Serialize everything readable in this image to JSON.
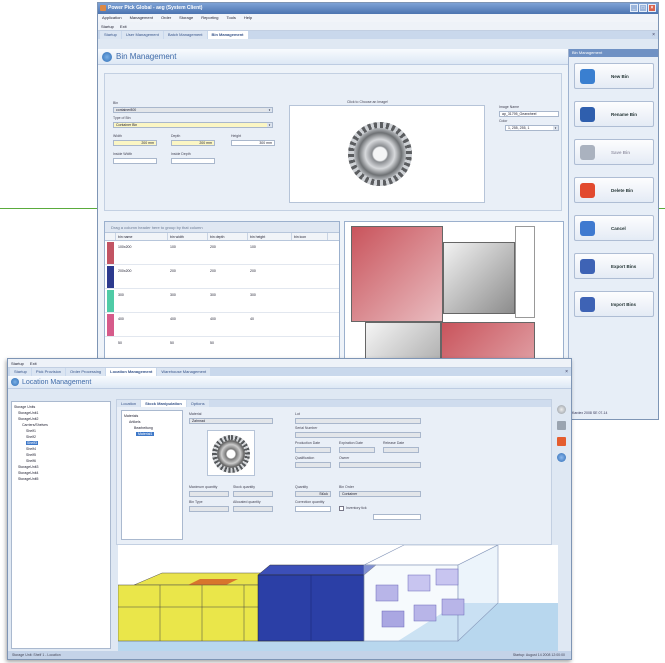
{
  "colors": {
    "accent": "#3e6aa8",
    "green_line": "#5aab3c",
    "red_block": "#c9545c",
    "yellow": "#f0ec4a",
    "blue": "#2a3fa8"
  },
  "window1": {
    "title": "Power Pick Global - aeg (System Client)",
    "menu": [
      "Application",
      "Management",
      "Order",
      "Storage",
      "Reporting",
      "Tools",
      "Help"
    ],
    "toolbar": [
      "Startup",
      "Exit"
    ],
    "tabs": [
      "Startup",
      "User Management",
      "Batch Management",
      "Bin Management"
    ],
    "header": "Bin Management",
    "form": {
      "bin_label": "Bin",
      "bin_value": "container800",
      "type_label": "Type of Bin",
      "type_value": "Container Bin",
      "width_label": "Width",
      "width_value": "200 mm",
      "depth_label": "Depth",
      "depth_value": "200 mm",
      "height_label": "Height",
      "height_value": "300 mm",
      "inside_width_label": "Inside Width",
      "inside_depth_label": "Inside Depth",
      "image_caption": "Click to Choose an Image!",
      "image_name_label": "Image Name",
      "image_name_value": "ap_31795_Gearwheel",
      "color_label": "Color",
      "color_value": "1, 255, 255, 1"
    },
    "grid": {
      "group_hint": "Drag a column header here to group by that column",
      "columns": [
        "bin name",
        "bin width",
        "bin depth",
        "bin height",
        "bin icon"
      ],
      "rows": [
        {
          "name": "100x200",
          "w": "100",
          "d": "200",
          "h": "100",
          "color": "#c25463"
        },
        {
          "name": "200x200",
          "w": "200",
          "d": "200",
          "h": "200",
          "color": "#2c3a8e"
        },
        {
          "name": "300",
          "w": "300",
          "d": "300",
          "h": "300",
          "color": "#4fcba6"
        },
        {
          "name": "400",
          "w": "400",
          "d": "400",
          "h": "40",
          "color": "#d65b8a"
        },
        {
          "name": "50",
          "w": "50",
          "d": "50",
          "h": "",
          "color": "#ffffff"
        }
      ]
    },
    "side_panel": {
      "title": "Bin Management",
      "buttons": [
        {
          "label": "New Bin",
          "icon": "new-bin-icon",
          "color": "#3a7fd0",
          "enabled": true
        },
        {
          "label": "Rename Bin",
          "icon": "save-icon",
          "color": "#2f5fae",
          "enabled": true
        },
        {
          "label": "Save Bin",
          "icon": "save-disabled-icon",
          "color": "#aab2bf",
          "enabled": false
        },
        {
          "label": "Delete Bin",
          "icon": "delete-icon",
          "color": "#e24a2f",
          "enabled": true
        },
        {
          "label": "Cancel",
          "icon": "undo-icon",
          "color": "#3f7ad0",
          "enabled": true
        },
        {
          "label": "Export Bins",
          "icon": "export-icon",
          "color": "#3e63b5",
          "enabled": true
        },
        {
          "label": "Import Bins",
          "icon": "import-icon",
          "color": "#3e63b5",
          "enabled": true
        }
      ],
      "footer": "Kardex 2008 SE 07-14"
    }
  },
  "window2": {
    "toolbar": [
      "Startup",
      "Exit"
    ],
    "tabs": [
      "Startup",
      "Pick Provision",
      "Order Processing",
      "Location Management",
      "Warehouse Management"
    ],
    "header": "Location Management",
    "tree": [
      "Storage Units",
      "StorageUnit1",
      "StorageUnit2",
      "Carriers/Shelves",
      "Shelf1",
      "Shelf2",
      "Shelf3",
      "Shelf4",
      "Shelf5",
      "Shelf6",
      "StorageUnit3",
      "StorageUnit4",
      "StorageUnit5"
    ],
    "subtabs": [
      "Location",
      "Stock Manipulation",
      "Options"
    ],
    "material_tree": [
      "Materials",
      "Artikels",
      "Bearbeitung",
      "Material1"
    ],
    "fields": {
      "material_label": "Material",
      "material_value": "Zahnrad",
      "lot_label": "Lot",
      "serial_label": "Serial Number",
      "production_date_label": "Production Date",
      "expiration_date_label": "Expiration Date",
      "release_date_label": "Release Date",
      "qualification_label": "Qualification",
      "owner_label": "Owner",
      "maxstock_label": "Maximum quantity",
      "stock_label": "Stock quantity",
      "quantity_label": "Quantity",
      "quantity_value": "Stück",
      "bin_order_label": "Bin Order",
      "bin_order_value": "Container",
      "correction_label": "Correction quantity",
      "stock_control_label": "Inventory tick",
      "bin_type_label": "Bin Type",
      "allocated_label": "Allocated quantity"
    },
    "status_left": "Storage Unit: Shelf 1 - Location",
    "status_right": "Startup: August 14 2008 12:00:00"
  }
}
